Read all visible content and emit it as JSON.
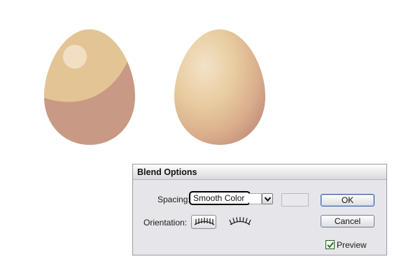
{
  "dialog": {
    "title": "Blend Options",
    "spacing": {
      "label": "Spacing:",
      "selected": "Smooth Color"
    },
    "orientation": {
      "label": "Orientation:",
      "options": [
        "align-to-page-icon",
        "align-to-path-icon"
      ]
    },
    "buttons": {
      "ok": "OK",
      "cancel": "Cancel"
    },
    "preview": {
      "label": "Preview",
      "checked": true
    }
  },
  "artwork": {
    "egg_left": {
      "base_color": "#c89a85",
      "top_color": "#e3c595",
      "highlight_color": "#f2dfc3"
    },
    "egg_right": {
      "light_color": "#f3e2c8",
      "mid_color": "#e6c79b",
      "dark_color": "#c9977f"
    }
  }
}
